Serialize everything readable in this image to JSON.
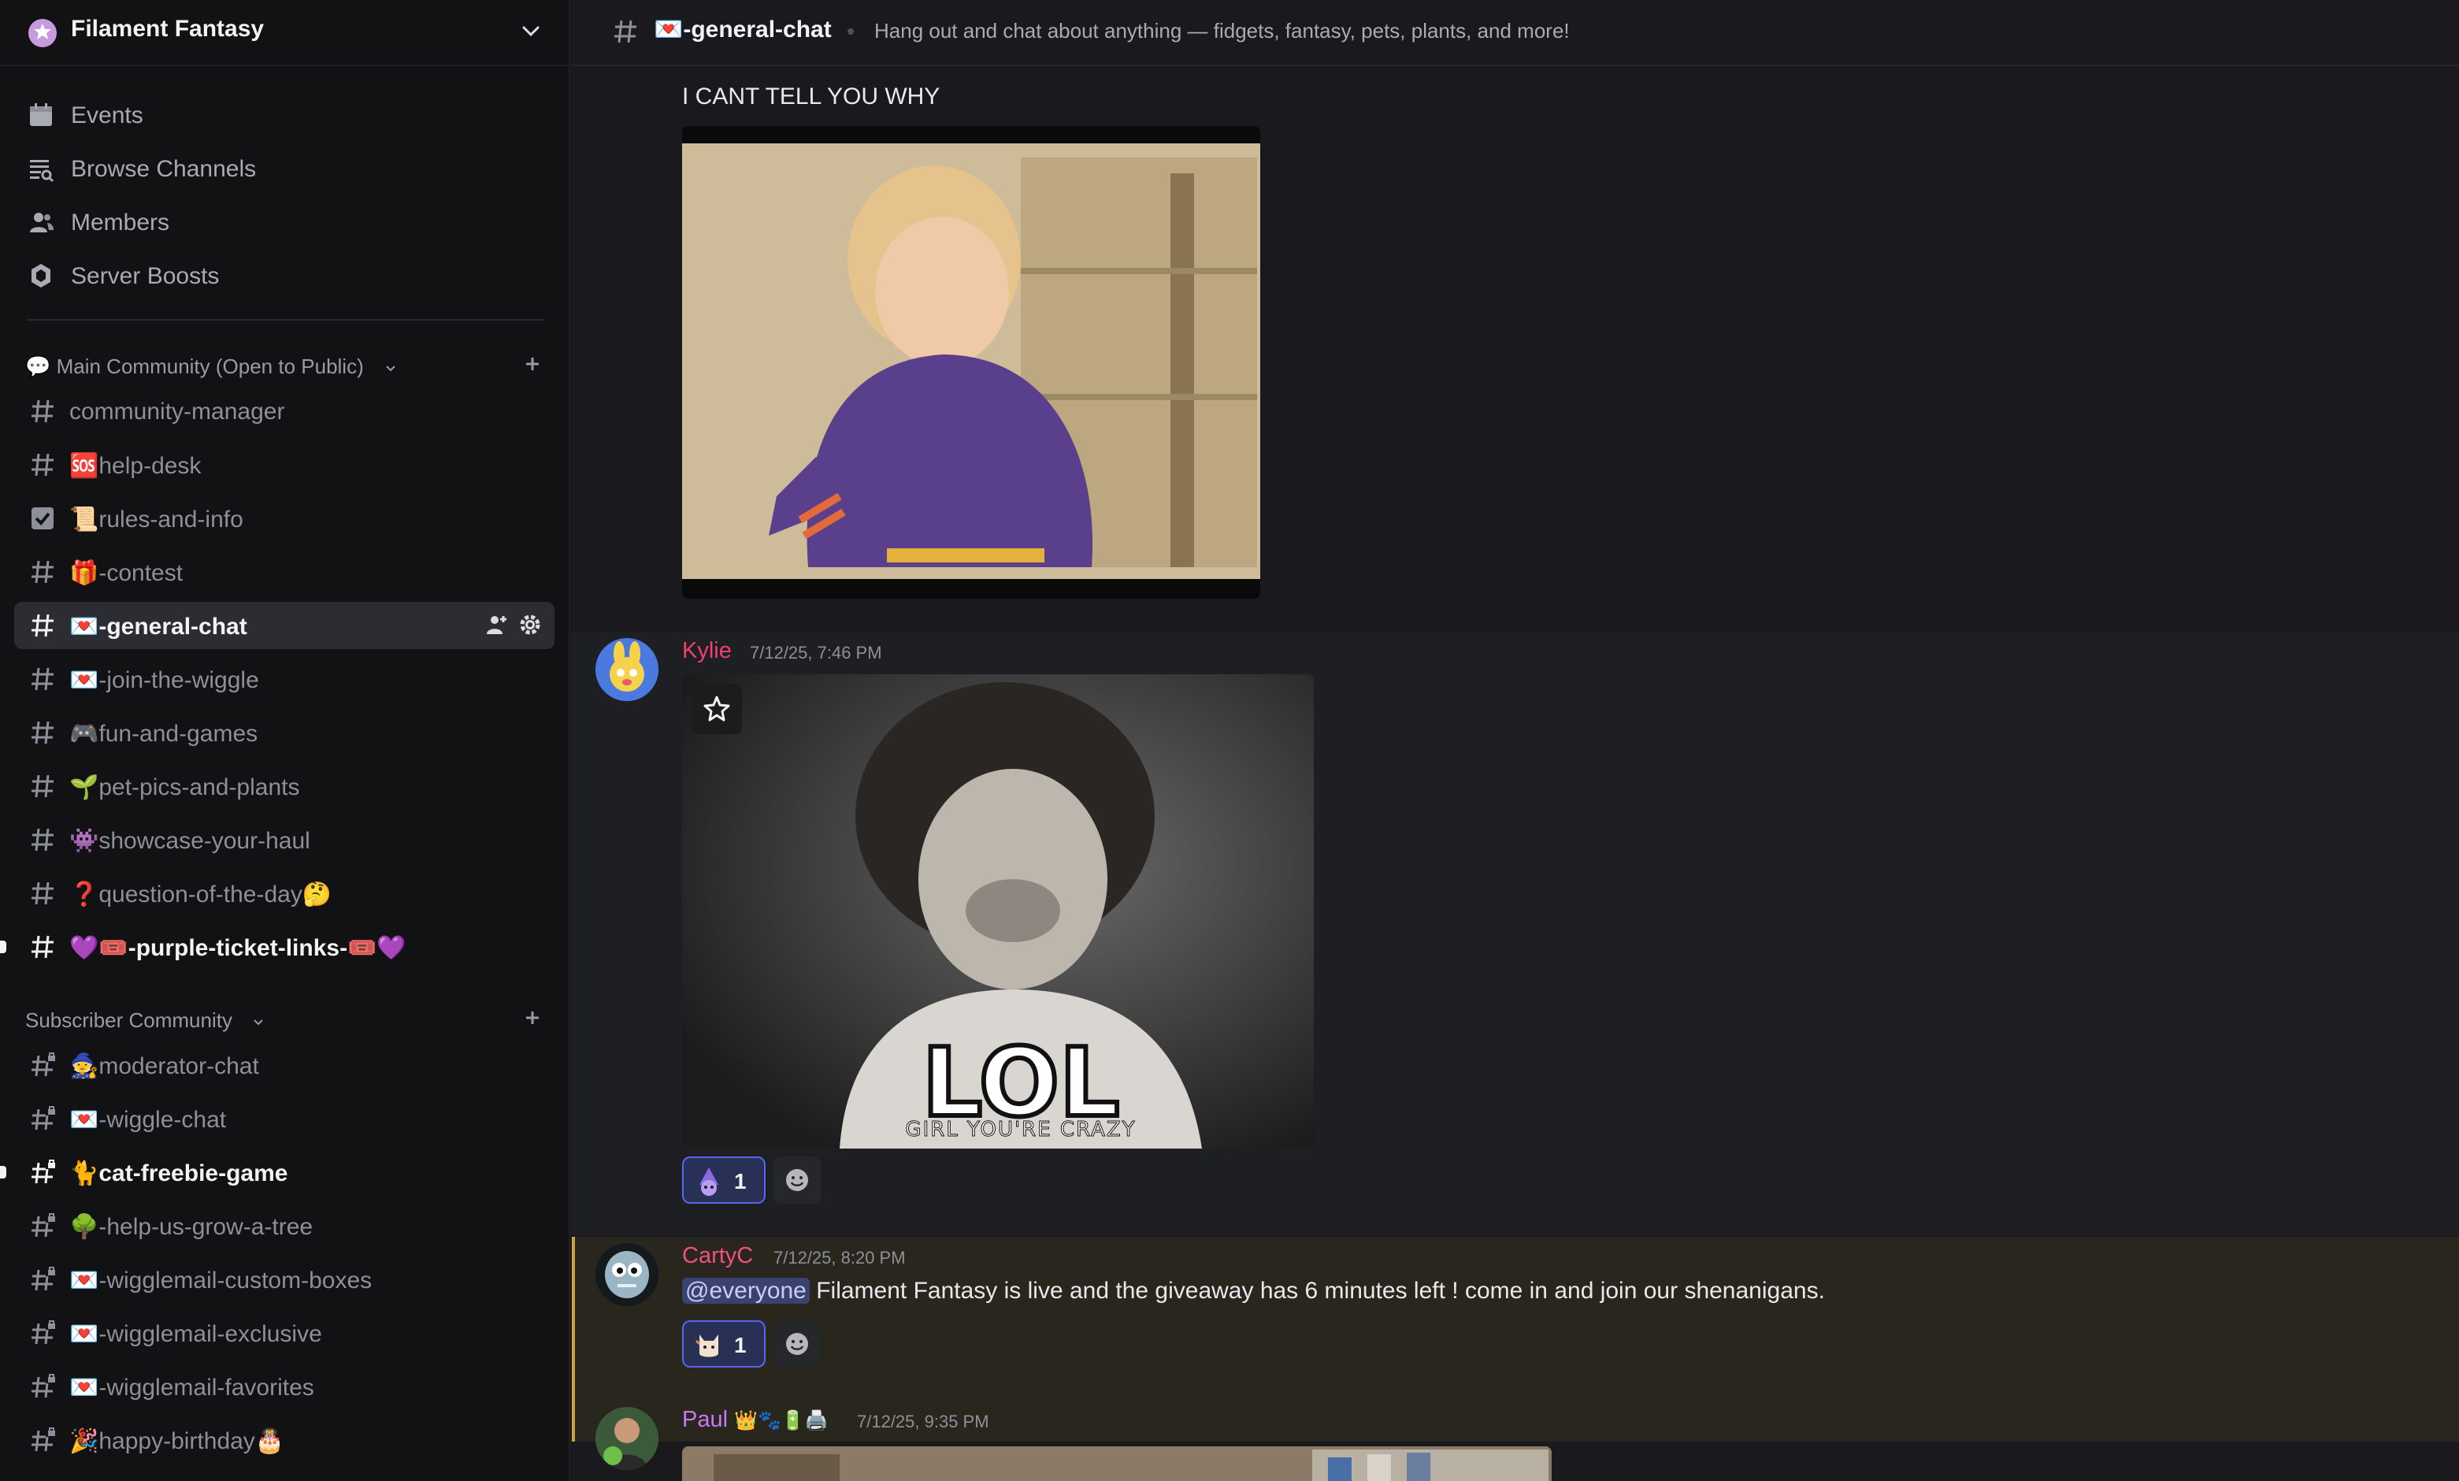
{
  "server": {
    "name": "Filament Fantasy"
  },
  "nav": [
    {
      "label": "Events",
      "icon": "calendar-icon"
    },
    {
      "label": "Browse Channels",
      "icon": "browse-channels-icon"
    },
    {
      "label": "Members",
      "icon": "members-icon"
    },
    {
      "label": "Server Boosts",
      "icon": "boost-icon"
    }
  ],
  "categories": [
    {
      "label": "💬 Main Community (Open to Public)"
    },
    {
      "label": "Subscriber Community"
    }
  ],
  "channels_main": [
    {
      "label": "community-manager"
    },
    {
      "label": "🆘help-desk"
    },
    {
      "label": "📜rules-and-info"
    },
    {
      "label": "🎁-contest"
    },
    {
      "label": "💌-general-chat"
    },
    {
      "label": "💌-join-the-wiggle"
    },
    {
      "label": "🎮fun-and-games"
    },
    {
      "label": "🌱pet-pics-and-plants"
    },
    {
      "label": "👾showcase-your-haul"
    },
    {
      "label": "❓question-of-the-day🤔"
    },
    {
      "label": "💜🎟️-purple-ticket-links-🎟️💜"
    }
  ],
  "channels_sub": [
    {
      "label": "🧙moderator-chat"
    },
    {
      "label": "💌-wiggle-chat"
    },
    {
      "label": "🐈cat-freebie-game"
    },
    {
      "label": "🌳-help-us-grow-a-tree"
    },
    {
      "label": "💌-wigglemail-custom-boxes"
    },
    {
      "label": "💌-wigglemail-exclusive"
    },
    {
      "label": "💌-wigglemail-favorites"
    },
    {
      "label": "🎉happy-birthday🎂"
    }
  ],
  "header": {
    "channel": "💌-general-chat",
    "topic": "Hang out and chat about anything — fidgets, fantasy, pets, plants, and more!"
  },
  "messages": [
    {
      "text": "I CANT TELL YOU WHY"
    },
    {
      "author": "Kylie",
      "time": "7/12/25, 7:46 PM",
      "gif_caption": "LOL",
      "gif_subcaption": "GIRL YOU'RE CRAZY",
      "reaction_count": "1",
      "author_color": "#f23f6f"
    },
    {
      "author": "CartyC",
      "time": "7/12/25, 8:20 PM",
      "mention": "@everyone",
      "text": "Filament Fantasy is live and the giveaway has 6 minutes left ! come in and join our shenanigans.",
      "reaction_count": "1",
      "author_color": "#f0517a"
    },
    {
      "author": "Paul",
      "badges": "👑🐾🔋🖨️",
      "time": "7/12/25, 9:35 PM",
      "author_color": "#c77bf3"
    }
  ]
}
